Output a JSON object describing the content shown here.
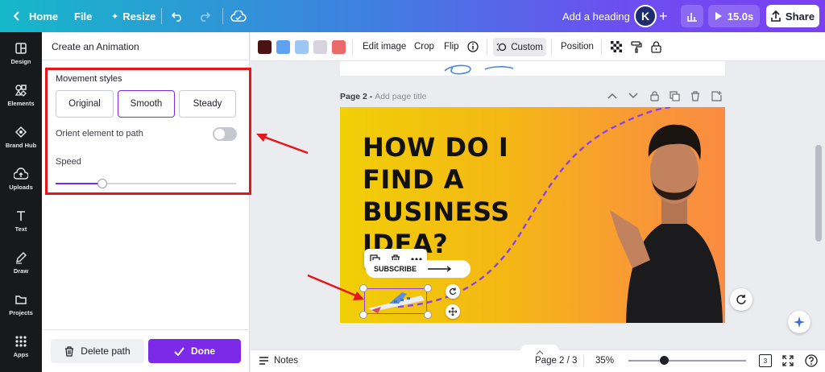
{
  "topbar": {
    "home_label": "Home",
    "file_label": "File",
    "resize_label": "Resize",
    "heading_label": "Add a heading",
    "avatar_initial": "K",
    "duration_label": "15.0s",
    "share_label": "Share"
  },
  "rail": {
    "items": [
      {
        "label": "Design",
        "icon": "layout-icon"
      },
      {
        "label": "Elements",
        "icon": "shapes-icon"
      },
      {
        "label": "Brand Hub",
        "icon": "brand-icon"
      },
      {
        "label": "Uploads",
        "icon": "upload-icon"
      },
      {
        "label": "Text",
        "icon": "text-icon"
      },
      {
        "label": "Draw",
        "icon": "pen-icon"
      },
      {
        "label": "Projects",
        "icon": "folder-icon"
      },
      {
        "label": "Apps",
        "icon": "grid-icon"
      }
    ]
  },
  "panel": {
    "title": "Create an Animation",
    "movement_label": "Movement styles",
    "styles": [
      "Original",
      "Smooth",
      "Steady"
    ],
    "active_style": "Smooth",
    "orient_label": "Orient element to path",
    "orient_on": false,
    "speed_label": "Speed",
    "speed_value": 0.26,
    "delete_label": "Delete path",
    "done_label": "Done"
  },
  "toolbar": {
    "colors": [
      "#4a1212",
      "#5ea1f0",
      "#9cc6f3",
      "#d6d2e0",
      "#ea6a6a"
    ],
    "edit_image": "Edit image",
    "crop": "Crop",
    "flip": "Flip",
    "custom": "Custom",
    "position": "Position"
  },
  "canvas": {
    "page_label": "Page 2",
    "page_title_placeholder": "Add page title",
    "headline": [
      "HOW DO I",
      "FIND A",
      "BUSINESS",
      "IDEA?"
    ],
    "subscribe_label": "SUBSCRIBE"
  },
  "bottom": {
    "notes_label": "Notes",
    "page_indicator": "Page 2 / 3",
    "zoom_label": "35%",
    "page_count": "3"
  },
  "accent": "#7d2ae8",
  "highlight_color": "#e3161b"
}
